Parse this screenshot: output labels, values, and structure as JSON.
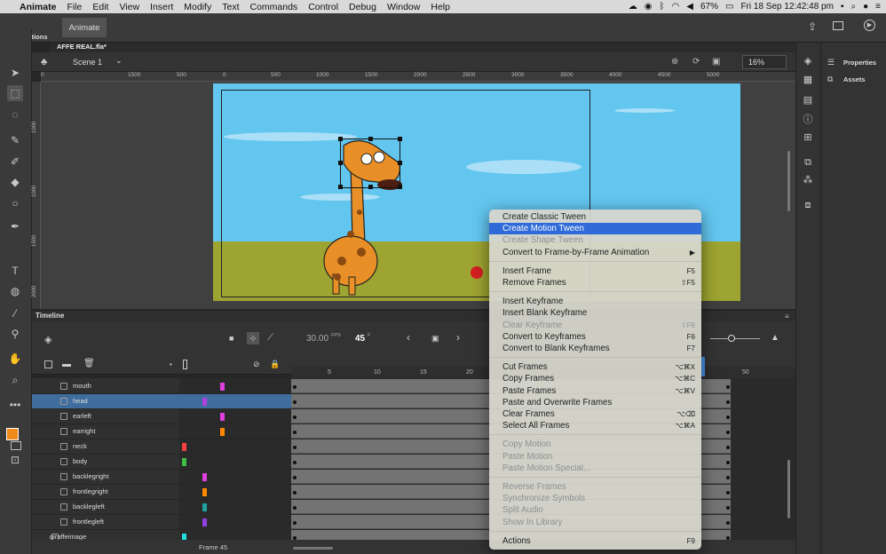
{
  "menubar": {
    "items": [
      "Animate",
      "File",
      "Edit",
      "View",
      "Insert",
      "Modify",
      "Text",
      "Commands",
      "Control",
      "Debug",
      "Window",
      "Help"
    ],
    "battery": "67%",
    "clock": "Fri 18 Sep  12:42:48 pm"
  },
  "app": {
    "workspace_tab": "Animate",
    "actions_label": "Actions",
    "doc_tab": "AFFE REAL.fla*"
  },
  "stage_toolbar": {
    "scene": "Scene 1",
    "zoom": "16%"
  },
  "ruler": {
    "h_labels": [
      "0",
      "1500",
      "1000",
      "500",
      "0",
      "500",
      "1000",
      "1500",
      "2000",
      "2500",
      "3000",
      "3500",
      "4000",
      "4500",
      "5000"
    ],
    "v_labels": [
      "500",
      "0",
      "500",
      "1000",
      "1500",
      "2000"
    ]
  },
  "right_panel": {
    "properties": "Properties",
    "assets": "Assets"
  },
  "timeline": {
    "title": "Timeline",
    "fps": "30.00",
    "fps_unit": "FPS",
    "frame": "45",
    "frame_unit": "F",
    "frame_numbers": [
      "5",
      "10",
      "15",
      "20",
      "50"
    ],
    "current_frame_label": "Frame 45",
    "layers": [
      {
        "name": "mouth",
        "color": "#e040e0"
      },
      {
        "name": "head",
        "color": "#b040e0"
      },
      {
        "name": "earleft",
        "color": "#e040e0"
      },
      {
        "name": "earright",
        "color": "#ff8a00"
      },
      {
        "name": "neck",
        "color": "#ff4040"
      },
      {
        "name": "body",
        "color": "#40c040"
      },
      {
        "name": "backlegright",
        "color": "#e040e0"
      },
      {
        "name": "frontlegright",
        "color": "#ff8a00"
      },
      {
        "name": "backlegleft",
        "color": "#20a0a0"
      },
      {
        "name": "frontlegleft",
        "color": "#9040e0"
      },
      {
        "name": "giraffeimage",
        "color": "#20e0e0"
      }
    ]
  },
  "context_menu": {
    "items": [
      {
        "label": "Create Classic Tween",
        "shortcut": "",
        "disabled": false
      },
      {
        "label": "Create Motion Tween",
        "shortcut": "",
        "disabled": false,
        "highlighted": true
      },
      {
        "label": "Create Shape Tween",
        "shortcut": "",
        "disabled": true
      },
      {
        "label": "Convert to Frame-by-Frame Animation",
        "shortcut": "▶",
        "disabled": false
      },
      {
        "label": "Insert Frame",
        "shortcut": "F5",
        "disabled": false
      },
      {
        "label": "Remove Frames",
        "shortcut": "⇧F5",
        "disabled": false
      },
      {
        "label": "Insert Keyframe",
        "shortcut": "",
        "disabled": false
      },
      {
        "label": "Insert Blank Keyframe",
        "shortcut": "",
        "disabled": false
      },
      {
        "label": "Clear Keyframe",
        "shortcut": "⇧F6",
        "disabled": true
      },
      {
        "label": "Convert to Keyframes",
        "shortcut": "F6",
        "disabled": false
      },
      {
        "label": "Convert to Blank Keyframes",
        "shortcut": "F7",
        "disabled": false
      },
      {
        "label": "Cut Frames",
        "shortcut": "⌥⌘X",
        "disabled": false
      },
      {
        "label": "Copy Frames",
        "shortcut": "⌥⌘C",
        "disabled": false
      },
      {
        "label": "Paste Frames",
        "shortcut": "⌥⌘V",
        "disabled": false
      },
      {
        "label": "Paste and Overwrite Frames",
        "shortcut": "",
        "disabled": false
      },
      {
        "label": "Clear Frames",
        "shortcut": "⌥⌫",
        "disabled": false
      },
      {
        "label": "Select All Frames",
        "shortcut": "⌥⌘A",
        "disabled": false
      },
      {
        "label": "Copy Motion",
        "shortcut": "",
        "disabled": true
      },
      {
        "label": "Paste Motion",
        "shortcut": "",
        "disabled": true
      },
      {
        "label": "Paste Motion Special...",
        "shortcut": "",
        "disabled": true
      },
      {
        "label": "Reverse Frames",
        "shortcut": "",
        "disabled": true
      },
      {
        "label": "Synchronize Symbols",
        "shortcut": "",
        "disabled": true
      },
      {
        "label": "Split Audio",
        "shortcut": "",
        "disabled": true
      },
      {
        "label": "Show In Library",
        "shortcut": "",
        "disabled": true
      },
      {
        "label": "Actions",
        "shortcut": "F9",
        "disabled": false
      }
    ]
  },
  "colors": {
    "highlight": "#2f6ad9",
    "selected_layer": "#3f6e9e",
    "stage": "#63c6ef",
    "ground": "#9ea431",
    "fill_swatch": "#f08a1c"
  }
}
